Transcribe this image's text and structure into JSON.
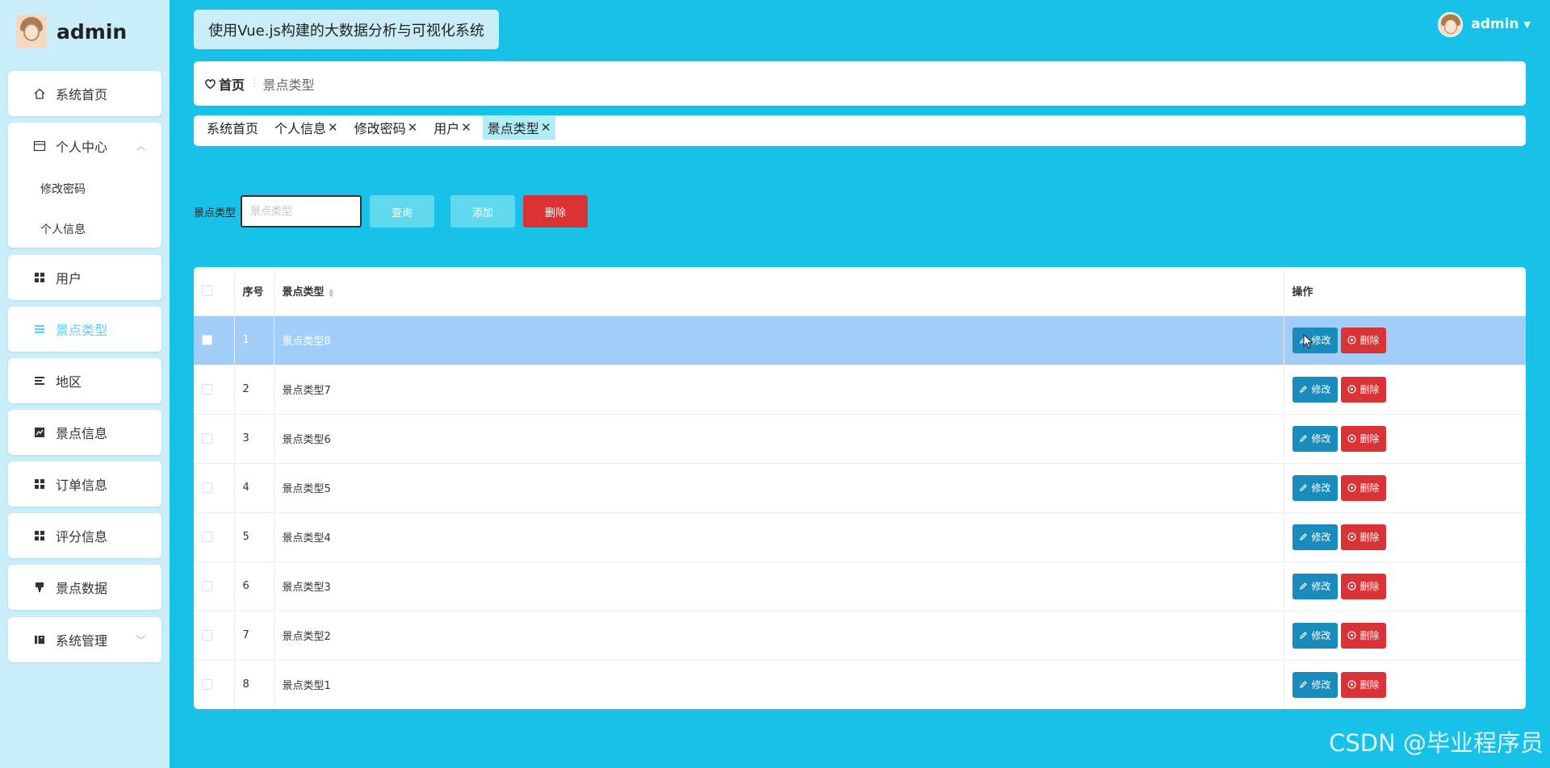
{
  "brand": {
    "name": "admin"
  },
  "system_title": "使用Vue.js构建的大数据分析与可视化系统",
  "user": {
    "name": "admin"
  },
  "sidebar": {
    "items": [
      {
        "label": "系统首页",
        "icon": "home-icon"
      },
      {
        "label": "个人中心",
        "icon": "user-center-icon",
        "children": [
          "修改密码",
          "个人信息"
        ]
      },
      {
        "label": "用户",
        "icon": "grid-icon"
      },
      {
        "label": "景点类型",
        "icon": "list-icon",
        "active": true
      },
      {
        "label": "地区",
        "icon": "lines-icon"
      },
      {
        "label": "景点信息",
        "icon": "chart-icon"
      },
      {
        "label": "订单信息",
        "icon": "grid-icon"
      },
      {
        "label": "评分信息",
        "icon": "grid-icon"
      },
      {
        "label": "景点数据",
        "icon": "brush-icon"
      },
      {
        "label": "系统管理",
        "icon": "book-icon"
      }
    ]
  },
  "breadcrumb": {
    "home": "首页",
    "current": "景点类型"
  },
  "tags": [
    {
      "label": "系统首页",
      "closable": false
    },
    {
      "label": "个人信息",
      "closable": true
    },
    {
      "label": "修改密码",
      "closable": true
    },
    {
      "label": "用户",
      "closable": true
    },
    {
      "label": "景点类型",
      "closable": true,
      "active": true
    }
  ],
  "search": {
    "label": "景点类型",
    "placeholder": "景点类型",
    "value": "",
    "query_label": "查询",
    "add_label": "添加",
    "delete_label": "删除"
  },
  "table": {
    "headers": {
      "index": "序号",
      "type": "景点类型",
      "actions": "操作"
    },
    "edit_label": "修改",
    "delete_label": "删除",
    "rows": [
      {
        "index": "1",
        "type": "景点类型8",
        "highlighted": true
      },
      {
        "index": "2",
        "type": "景点类型7"
      },
      {
        "index": "3",
        "type": "景点类型6"
      },
      {
        "index": "4",
        "type": "景点类型5"
      },
      {
        "index": "5",
        "type": "景点类型4"
      },
      {
        "index": "6",
        "type": "景点类型3"
      },
      {
        "index": "7",
        "type": "景点类型2"
      },
      {
        "index": "8",
        "type": "景点类型1"
      }
    ]
  },
  "watermark": "CSDN @毕业程序员",
  "colors": {
    "background": "#17c1e8",
    "sidebar": "#c9eef9",
    "accent": "#5bd2ea",
    "danger": "#dc3133",
    "edit": "#1a8bbd",
    "row_highlight": "#a0cef8"
  }
}
